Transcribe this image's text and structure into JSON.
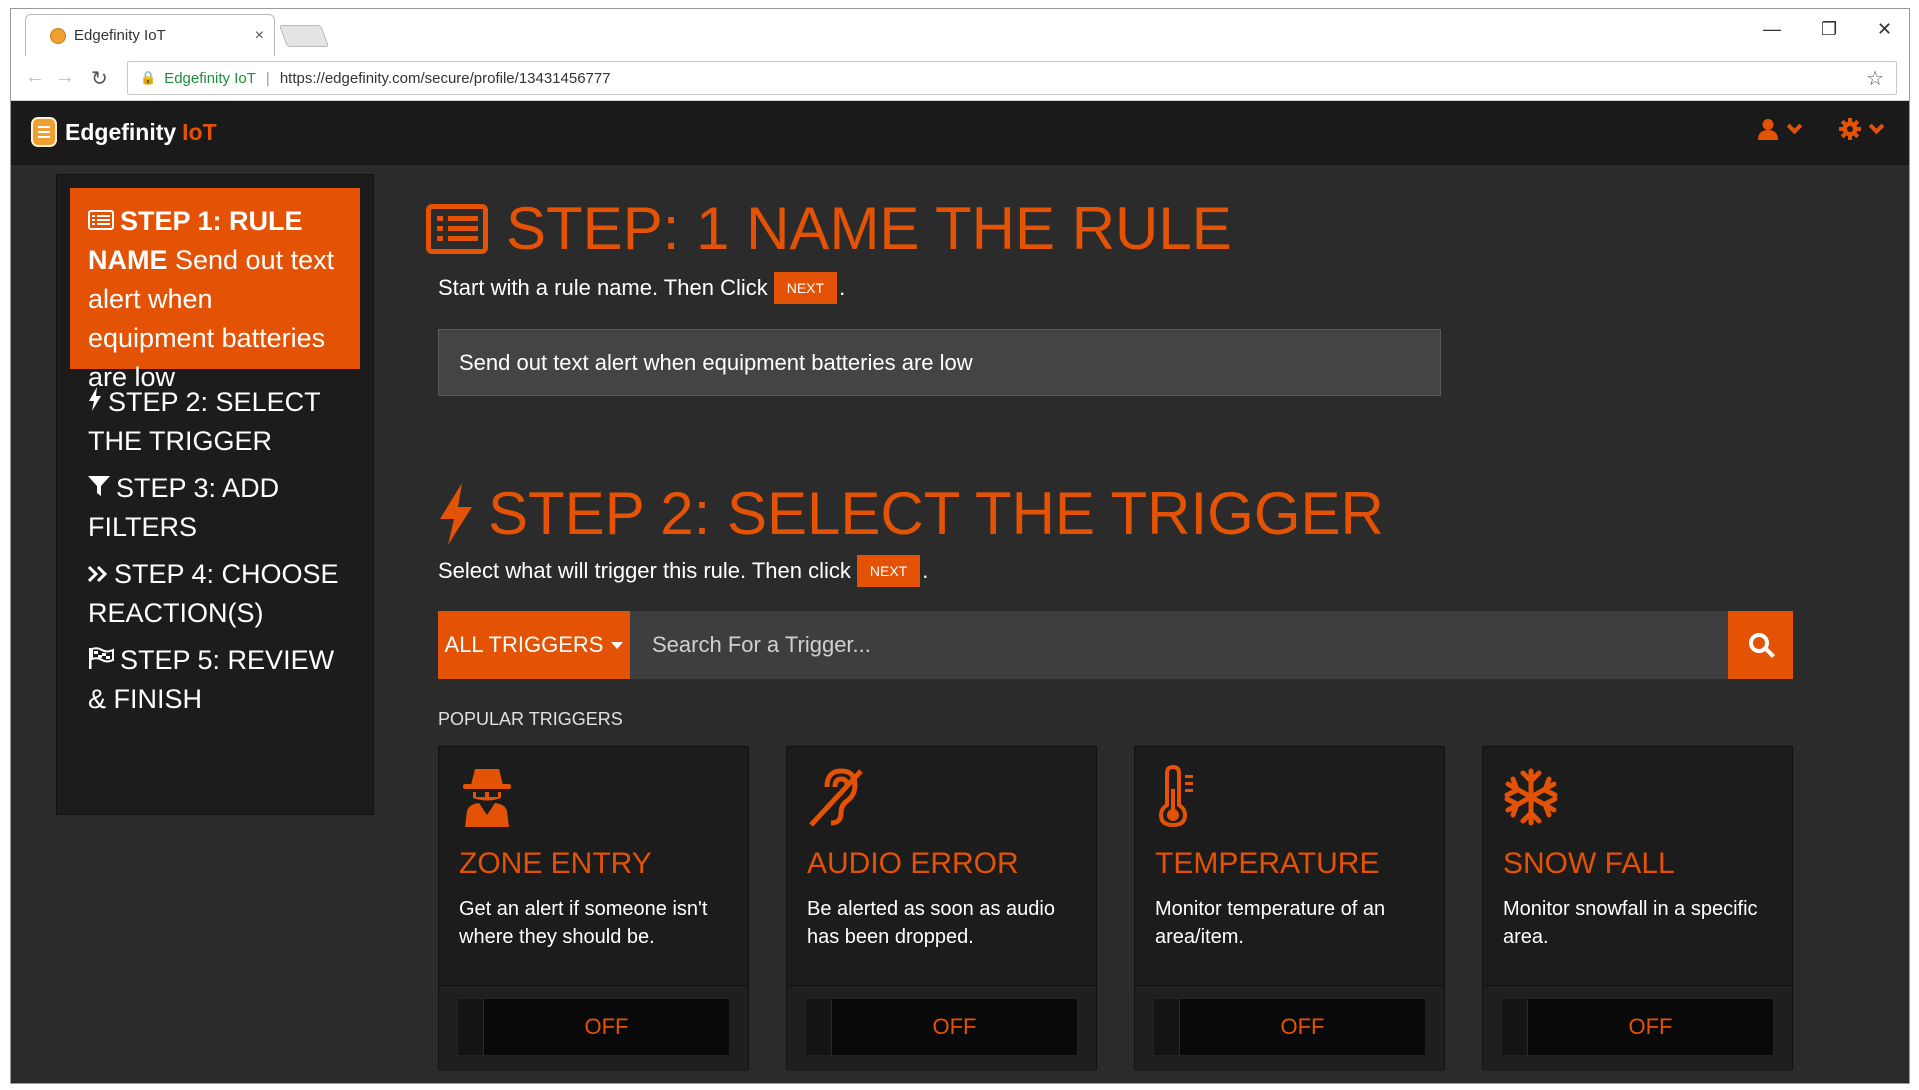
{
  "browser": {
    "tab_title": "Edgefinity IoT",
    "tab_close": "×",
    "site_name": "Edgefinity IoT",
    "url": "https://edgefinity.com/secure/profile/13431456777",
    "minimize": "—",
    "restore": "❐",
    "close": "✕"
  },
  "app": {
    "brand_main": "Edgefinity",
    "brand_accent": "IoT",
    "accent_color": "#e35205"
  },
  "sidebar": {
    "active": {
      "label": "STEP 1: RULE NAME",
      "detail": " Send out text alert when equipment batteries are low"
    },
    "items": [
      {
        "label": "STEP 2: SELECT THE TRIGGER",
        "icon": "bolt-icon"
      },
      {
        "label": "STEP 3: ADD FILTERS",
        "icon": "filter-icon"
      },
      {
        "label": "STEP 4: CHOOSE REACTION(S)",
        "icon": "double-chevron-icon"
      },
      {
        "label": "STEP 5: REVIEW & FINISH",
        "icon": "flag-icon"
      }
    ]
  },
  "step1": {
    "title": "STEP: 1 NAME THE RULE",
    "instruction": "Start with a rule name. Then Click",
    "next": "NEXT",
    "period": ".",
    "rule_name": "Send out text alert when equipment batteries are low"
  },
  "step2": {
    "title": "STEP 2: SELECT THE TRIGGER",
    "instruction": "Select what will trigger this rule. Then click",
    "next": "NEXT",
    "period": ".",
    "dropdown": "ALL TRIGGERS",
    "search_placeholder": "Search For a Trigger...",
    "popular_label": "POPULAR TRIGGERS"
  },
  "triggers": [
    {
      "title": "ZONE ENTRY",
      "desc": "Get an alert if someone isn't where they should be.",
      "state": "OFF",
      "icon": "spy-icon"
    },
    {
      "title": "AUDIO ERROR",
      "desc": "Be alerted as soon as audio has been dropped.",
      "state": "OFF",
      "icon": "hearing-impaired-icon"
    },
    {
      "title": "TEMPERATURE",
      "desc": "Monitor temperature of an area/item.",
      "state": "OFF",
      "icon": "thermometer-icon"
    },
    {
      "title": "SNOW FALL",
      "desc": "Monitor snowfall in a specific area.",
      "state": "OFF",
      "icon": "snowflake-icon"
    }
  ]
}
